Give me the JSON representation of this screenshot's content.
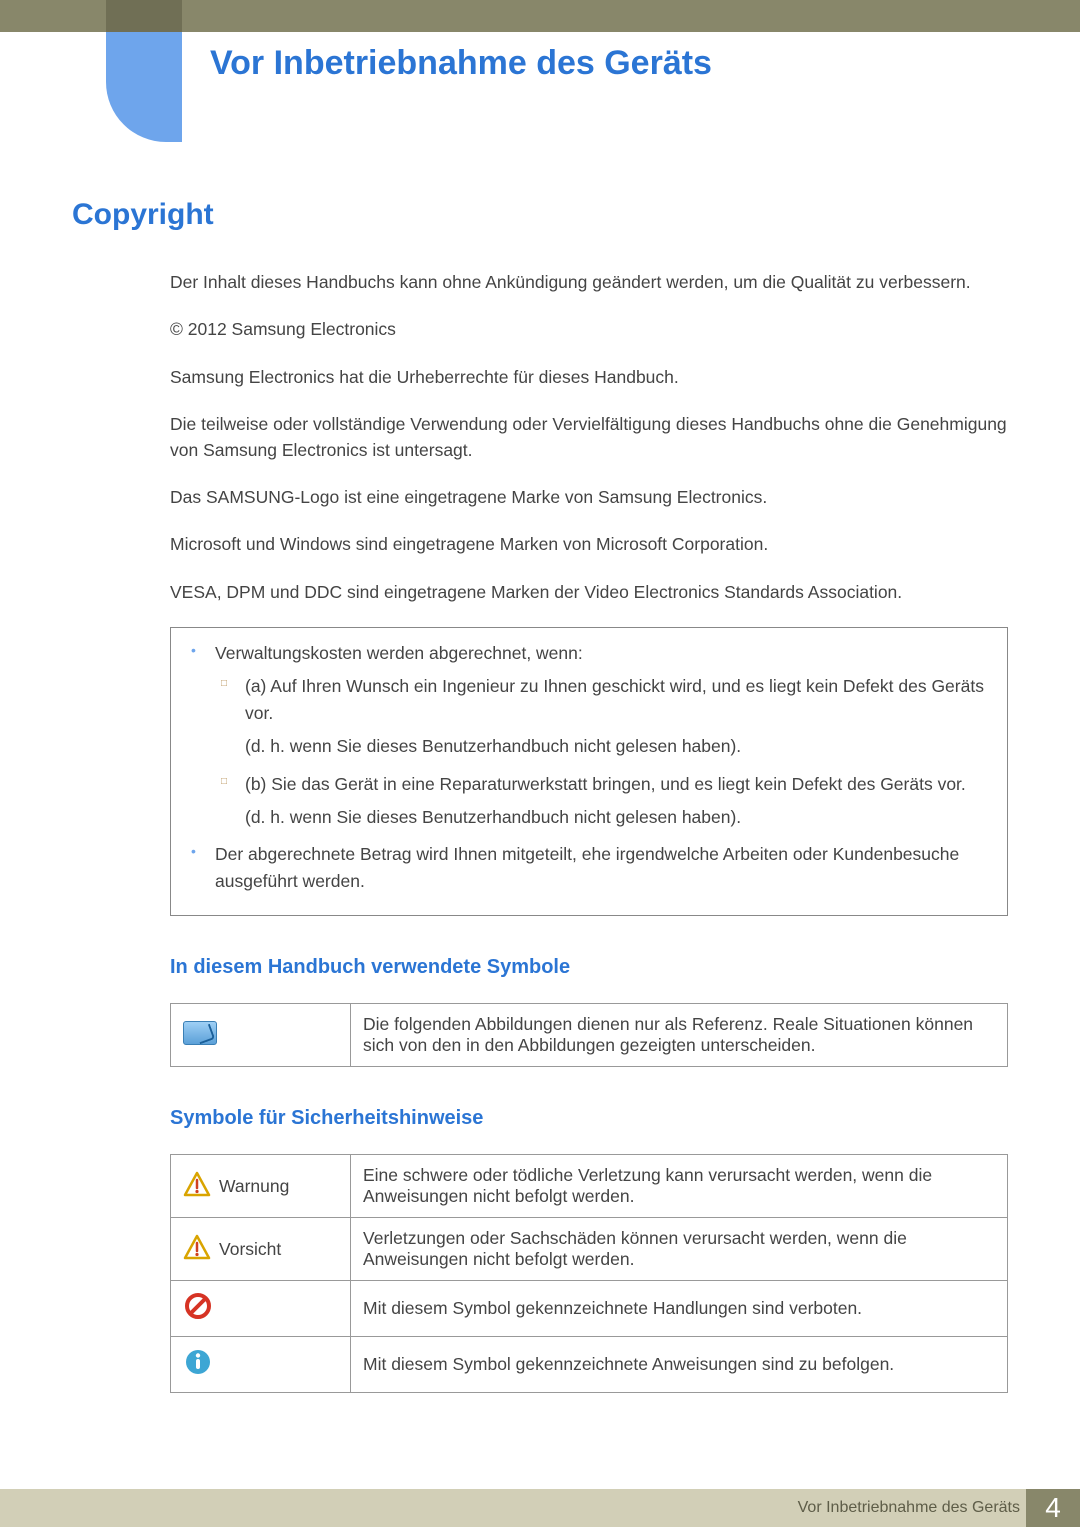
{
  "chapter_title": "Vor Inbetriebnahme des Geräts",
  "section_title": "Copyright",
  "paragraphs": [
    "Der Inhalt dieses Handbuchs kann ohne Ankündigung geändert werden, um die Qualität zu verbessern.",
    "© 2012 Samsung Electronics",
    "Samsung Electronics hat die Urheberrechte für dieses Handbuch.",
    "Die teilweise oder vollständige Verwendung oder Vervielfältigung dieses Handbuchs ohne die Genehmigung von Samsung Electronics ist untersagt.",
    "Das SAMSUNG-Logo ist eine eingetragene Marke von Samsung Electronics.",
    "Microsoft und Windows sind eingetragene Marken von Microsoft Corporation.",
    "VESA, DPM und DDC sind eingetragene Marken der Video Electronics Standards Association."
  ],
  "note_box": {
    "item1_intro": "Verwaltungskosten werden abgerechnet, wenn:",
    "sub_a": "(a) Auf Ihren Wunsch ein Ingenieur zu Ihnen geschickt wird, und es liegt kein Defekt des Geräts vor.",
    "sub_a_extra": "(d. h. wenn Sie dieses Benutzerhandbuch nicht gelesen haben).",
    "sub_b": "(b) Sie das Gerät in eine Reparaturwerkstatt bringen, und es liegt kein Defekt des Geräts vor.",
    "sub_b_extra": "(d. h. wenn Sie dieses Benutzerhandbuch nicht gelesen haben).",
    "item2": "Der abgerechnete Betrag wird Ihnen mitgeteilt, ehe irgendwelche Arbeiten oder Kundenbesuche ausgeführt werden."
  },
  "sub1_title": "In diesem Handbuch verwendete Symbole",
  "symbols_1_desc": "Die folgenden Abbildungen dienen nur als Referenz. Reale Situationen können sich von den in den Abbildungen gezeigten unterscheiden.",
  "sub2_title": "Symbole für Sicherheitshinweise",
  "safety": {
    "warning_label": "Warnung",
    "warning_desc": "Eine schwere oder tödliche Verletzung kann verursacht werden, wenn die Anweisungen nicht befolgt werden.",
    "caution_label": "Vorsicht",
    "caution_desc": "Verletzungen oder Sachschäden können verursacht werden, wenn die Anweisungen nicht befolgt werden.",
    "prohibit_desc": "Mit diesem Symbol gekennzeichnete Handlungen sind verboten.",
    "info_desc": "Mit diesem Symbol gekennzeichnete Anweisungen sind zu befolgen."
  },
  "footer_label": "Vor Inbetriebnahme des Geräts",
  "page_number": "4"
}
